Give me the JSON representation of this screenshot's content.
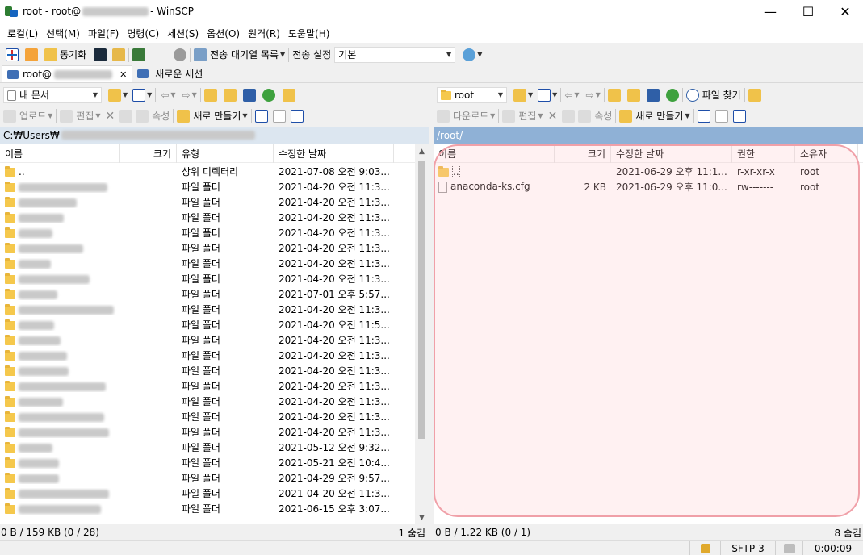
{
  "window": {
    "title_prefix": "root - root@",
    "title_suffix": " - WinSCP",
    "minimize": "—",
    "maximize": "☐",
    "close": "✕"
  },
  "menu": [
    "로컬(L)",
    "선택(M)",
    "파일(F)",
    "명령(C)",
    "세션(S)",
    "옵션(O)",
    "원격(R)",
    "도움말(H)"
  ],
  "toolbar": {
    "sync_label": "동기화",
    "queue_label": "전송 대기열 목록",
    "transfer_settings_label": "전송 설정",
    "transfer_preset": "기본"
  },
  "tabs": {
    "session_tab": "root@",
    "session_close": "✕",
    "new_session": "새로운 세션"
  },
  "left": {
    "location": "내 문서",
    "upload": "업로드",
    "edit": "편집",
    "properties": "속성",
    "new": "새로 만들기",
    "path": "C:₩Users₩",
    "headers": {
      "name": "이름",
      "size": "크기",
      "type": "유형",
      "modified": "수정한 날짜"
    },
    "rows": [
      {
        "name": "..",
        "type": "상위 디렉터리",
        "date": "2021-07-08  오전 9:03..."
      },
      {
        "type": "파일 폴더",
        "date": "2021-04-20  오전 11:3..."
      },
      {
        "type": "파일 폴더",
        "date": "2021-04-20  오전 11:3..."
      },
      {
        "type": "파일 폴더",
        "date": "2021-04-20  오전 11:3..."
      },
      {
        "type": "파일 폴더",
        "date": "2021-04-20  오전 11:3..."
      },
      {
        "type": "파일 폴더",
        "date": "2021-04-20  오전 11:3..."
      },
      {
        "type": "파일 폴더",
        "date": "2021-04-20  오전 11:3..."
      },
      {
        "type": "파일 폴더",
        "date": "2021-04-20  오전 11:3..."
      },
      {
        "type": "파일 폴더",
        "date": "2021-07-01  오후 5:57..."
      },
      {
        "type": "파일 폴더",
        "date": "2021-04-20  오전 11:3..."
      },
      {
        "type": "파일 폴더",
        "date": "2021-04-20  오전 11:5..."
      },
      {
        "type": "파일 폴더",
        "date": "2021-04-20  오전 11:3..."
      },
      {
        "type": "파일 폴더",
        "date": "2021-04-20  오전 11:3..."
      },
      {
        "type": "파일 폴더",
        "date": "2021-04-20  오전 11:3..."
      },
      {
        "type": "파일 폴더",
        "date": "2021-04-20  오전 11:3..."
      },
      {
        "type": "파일 폴더",
        "date": "2021-04-20  오전 11:3..."
      },
      {
        "type": "파일 폴더",
        "date": "2021-04-20  오전 11:3..."
      },
      {
        "type": "파일 폴더",
        "date": "2021-04-20  오전 11:3..."
      },
      {
        "type": "파일 폴더",
        "date": "2021-05-12  오전 9:32..."
      },
      {
        "type": "파일 폴더",
        "date": "2021-05-21  오전 10:4..."
      },
      {
        "type": "파일 폴더",
        "date": "2021-04-29  오전 9:57..."
      },
      {
        "type": "파일 폴더",
        "date": "2021-04-20  오전 11:3..."
      },
      {
        "type": "파일 폴더",
        "date": "2021-06-15  오후 3:07..."
      }
    ],
    "status": "0 B / 159 KB (0 / 28)",
    "hidden": "1 숨김"
  },
  "right": {
    "location": "root",
    "find_files": "파일 찾기",
    "download": "다운로드",
    "edit": "편집",
    "properties": "속성",
    "new": "새로 만들기",
    "path": "/root/",
    "headers": {
      "name": "이름",
      "size": "크기",
      "modified": "수정한 날짜",
      "rights": "권한",
      "owner": "소유자"
    },
    "rows": [
      {
        "name": "..",
        "size": "",
        "date": "2021-06-29  오후 11:1...",
        "rights": "r-xr-xr-x",
        "owner": "root"
      },
      {
        "name": "anaconda-ks.cfg",
        "size": "2 KB",
        "date": "2021-06-29  오후 11:0...",
        "rights": "rw-------",
        "owner": "root"
      }
    ],
    "status": "0 B / 1.22 KB (0 / 1)",
    "hidden": "8 숨김"
  },
  "bottom": {
    "protocol": "SFTP-3",
    "time": "0:00:09"
  }
}
